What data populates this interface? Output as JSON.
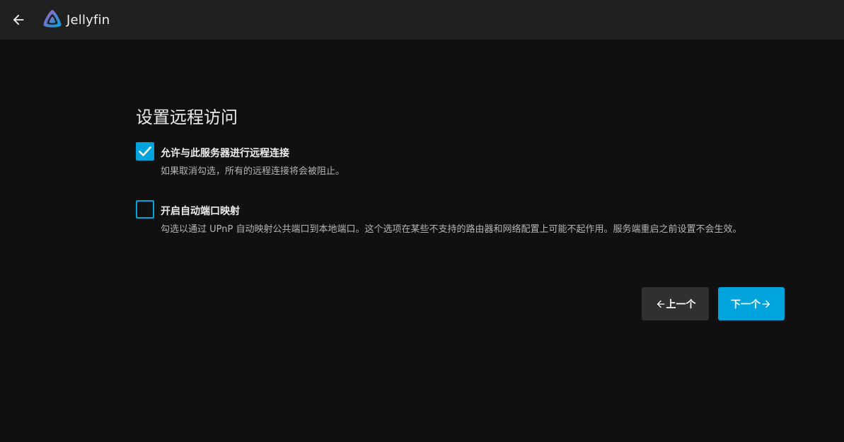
{
  "header": {
    "app_name": "Jellyfin",
    "icons": {
      "back": "arrow-left-icon",
      "logo": "jellyfin-logo-icon"
    }
  },
  "page": {
    "title": "设置远程访问"
  },
  "options": [
    {
      "label": "允许与此服务器进行远程连接",
      "description": "如果取消勾选，所有的远程连接将会被阻止。",
      "checked": true
    },
    {
      "label": "开启自动端口映射",
      "description": "勾选以通过 UPnP 自动映射公共端口到本地端口。这个选项在某些不支持的路由器和网络配置上可能不起作用。服务端重启之前设置不会生效。",
      "checked": false
    }
  ],
  "buttons": {
    "previous_label": "上一个",
    "next_label": "下一个"
  },
  "colors": {
    "accent": "#00a4dc",
    "header_bg": "#202020",
    "page_bg": "#101010",
    "secondary_button": "#303030"
  }
}
